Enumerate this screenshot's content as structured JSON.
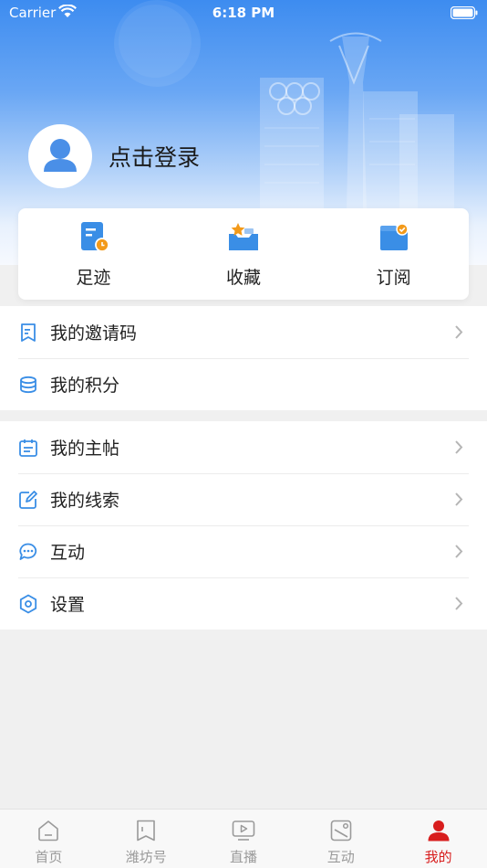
{
  "status_bar": {
    "carrier": "Carrier",
    "time": "6:18 PM"
  },
  "profile": {
    "login_label": "点击登录"
  },
  "quick_actions": [
    {
      "label": "足迹",
      "icon": "footprint-icon"
    },
    {
      "label": "收藏",
      "icon": "favorites-icon"
    },
    {
      "label": "订阅",
      "icon": "subscribe-icon"
    }
  ],
  "menu_group_1": [
    {
      "label": "我的邀请码",
      "icon": "invite-code-icon",
      "has_chevron": true
    },
    {
      "label": "我的积分",
      "icon": "points-icon",
      "has_chevron": false
    }
  ],
  "menu_group_2": [
    {
      "label": "我的主帖",
      "icon": "posts-icon",
      "has_chevron": true
    },
    {
      "label": "我的线索",
      "icon": "clues-icon",
      "has_chevron": true
    },
    {
      "label": "互动",
      "icon": "interaction-icon",
      "has_chevron": true
    },
    {
      "label": "设置",
      "icon": "settings-icon",
      "has_chevron": true
    }
  ],
  "tab_bar": [
    {
      "label": "首页",
      "icon": "home-icon",
      "active": false
    },
    {
      "label": "潍坊号",
      "icon": "bookmark-icon",
      "active": false
    },
    {
      "label": "直播",
      "icon": "live-icon",
      "active": false
    },
    {
      "label": "互动",
      "icon": "interaction-tab-icon",
      "active": false
    },
    {
      "label": "我的",
      "icon": "profile-icon",
      "active": true
    }
  ],
  "colors": {
    "accent_blue": "#3d8cf0",
    "active_tab": "#d81e1e",
    "inactive_tab": "#9a9a9a",
    "icon_blue": "#3a8ee6",
    "icon_orange": "#f39a1a"
  }
}
